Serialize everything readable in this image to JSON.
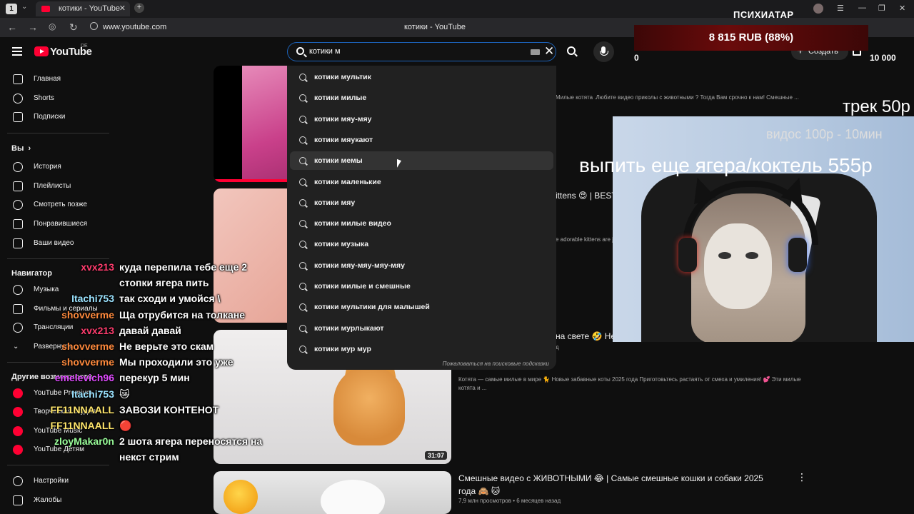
{
  "browser": {
    "tab_number": "1",
    "tab_title": "котики - YouTube",
    "url": "www.youtube.com",
    "page_title": "котики - YouTube"
  },
  "youtube": {
    "logo_text": "YouTube",
    "region": "DE",
    "search": {
      "value": "котики м",
      "suggestions": [
        "котики мультик",
        "котики милые",
        "котики мяу-мяу",
        "котики мяукают",
        "котики мемы",
        "котики маленькие",
        "котики мяу",
        "котики милые видео",
        "котики музыка",
        "котики мяу-мяу-мяу-мяу",
        "котики милые и смешные",
        "котики мультики для малышей",
        "котики мурлыкают",
        "котики мур мур"
      ],
      "hovered_index": 4,
      "report_text": "Пожаловаться на поисковые подсказки"
    },
    "create_label": "Создать",
    "sidebar": {
      "main": [
        "Главная",
        "Shorts",
        "Подписки"
      ],
      "you_header": "Вы",
      "you": [
        "История",
        "Плейлисты",
        "Смотреть позже",
        "Понравившиеся",
        "Ваши видео"
      ],
      "nav_header": "Навигатор",
      "nav": [
        "Музыка",
        "Фильмы и сериалы",
        "Трансляции",
        "Развернуть"
      ],
      "more_header": "Другие возможности",
      "more": [
        "YouTube Premium",
        "Творческая студия",
        "YouTube Music",
        "YouTube Детям"
      ],
      "settings": [
        "Настройки",
        "Жалобы"
      ]
    },
    "results": {
      "top_desc": "Милые котята .Любите видео приколы с животными ? Тогда Вам срочно к нам! Смешные ...",
      "frag_title1": "ittens 😍 | BEST",
      "frag_desc1": "e adorable kittens are ju",
      "frag_title2": "на свете 🤣 Не",
      "frag_meta2": "д",
      "desc3": "Котята — самые милые в мире 🐈 Новые забавные коты 2025 года Приготовьтесь растаять от смеха и умиления! 💕 Эти милые котята и ...",
      "duration3": "31:07",
      "title4": "Смешные видео с ЖИВОТНЫМИ 😂 | Самые смешные кошки и собаки 2025 года 🙈 🐱",
      "stats4": "7,9 млн просмотров • 6 месяцев назад"
    }
  },
  "overlay": {
    "streamer": "ПСИХИАТАР",
    "donation": "8 815 RUB (88%)",
    "left_num": "0",
    "right_num": "10 000",
    "track": "трек 50р",
    "video": "видос 100р - 10мин",
    "drink": "выпить еще  ягера/коктель 555р"
  },
  "chat": [
    {
      "user": "xvx213",
      "msg": "куда перепила тебе еще 2",
      "color": "#ff3d6e"
    },
    {
      "user": "",
      "msg": "стопки ягера пить",
      "color": "#ffffff"
    },
    {
      "user": "Itachi753",
      "msg": "так сходи и умойся \\",
      "color": "#9be3ff"
    },
    {
      "user": "shovverme",
      "msg": "Ща отрубится на толкане",
      "color": "#ff8a3d"
    },
    {
      "user": "xvx213",
      "msg": "давай давай",
      "color": "#ff3d6e"
    },
    {
      "user": "shovverme",
      "msg": "Не верьте это скам",
      "color": "#ff8a3d"
    },
    {
      "user": "shovverme",
      "msg": "Мы проходили это уже",
      "color": "#ff8a3d"
    },
    {
      "user": "emelevich96",
      "msg": "перекур 5 мин",
      "color": "#e04bff"
    },
    {
      "user": "Itachi753",
      "msg": "😿",
      "color": "#9be3ff"
    },
    {
      "user": "FF11NNAALL",
      "msg": "ЗАВОЗИ КОНТЕНОТ",
      "color": "#ffe66b"
    },
    {
      "user": "FF11NNAALL",
      "msg": "🔴",
      "color": "#ffe66b"
    },
    {
      "user": "zloyMakar0n",
      "msg": "2 шота ягера переносятся на",
      "color": "#9bff9b"
    },
    {
      "user": "",
      "msg": "некст стрим",
      "color": "#ffffff"
    }
  ]
}
